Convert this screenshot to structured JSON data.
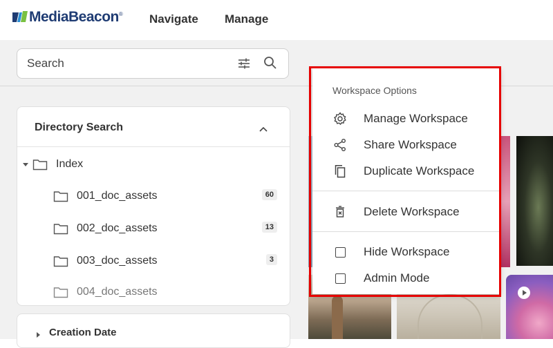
{
  "header": {
    "logo_text": "MediaBeacon",
    "logo_mark": "®",
    "nav_items": [
      "Navigate",
      "Manage"
    ]
  },
  "search": {
    "placeholder": "Search",
    "filter_icon": "filter-sliders-icon",
    "search_icon": "search-icon"
  },
  "directory_panel": {
    "title": "Directory Search",
    "root": {
      "label": "Index",
      "expanded": true
    },
    "folders": [
      {
        "label": "001_doc_assets",
        "count": "60"
      },
      {
        "label": "002_doc_assets",
        "count": "13"
      },
      {
        "label": "003_doc_assets",
        "count": "3"
      },
      {
        "label": "004_doc_assets",
        "count": ""
      }
    ]
  },
  "creation_panel": {
    "title": "Creation Date"
  },
  "workspace_menu": {
    "header": "Workspace Options",
    "items": [
      {
        "label": "Manage Workspace",
        "icon": "gear-icon"
      },
      {
        "label": "Share Workspace",
        "icon": "share-icon"
      },
      {
        "label": "Duplicate Workspace",
        "icon": "copy-icon"
      },
      {
        "label": "Delete Workspace",
        "icon": "delete-icon"
      },
      {
        "label": "Hide Workspace",
        "icon": "checkbox-icon",
        "checked": false
      },
      {
        "label": "Admin Mode",
        "icon": "checkbox-icon",
        "checked": false
      }
    ]
  },
  "colors": {
    "highlight": "#e60000",
    "brand": "#1f3c73"
  }
}
